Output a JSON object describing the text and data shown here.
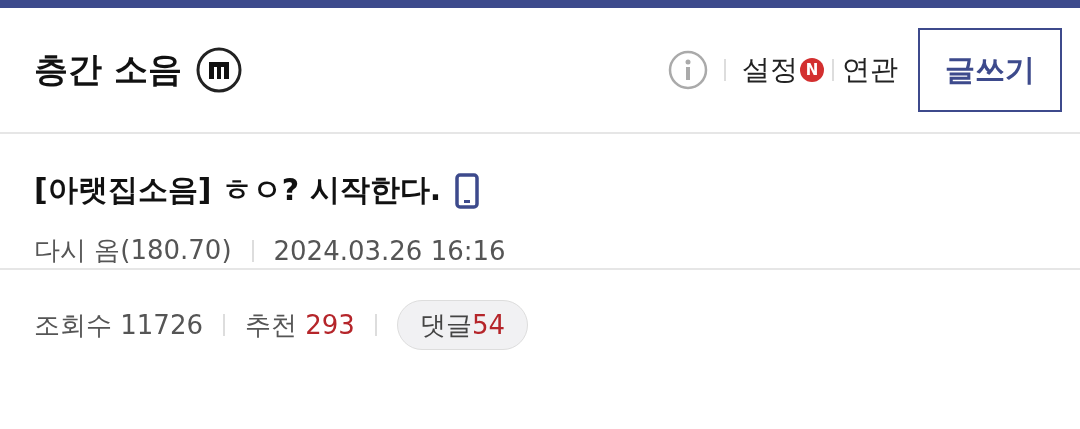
{
  "board": {
    "title": "층간 소음",
    "links": [
      {
        "label": "설정",
        "badge": "N"
      },
      {
        "label": "연관"
      }
    ],
    "write_button": "글쓰기"
  },
  "post": {
    "title": "[아랫집소음] ㅎㅇ? 시작한다.",
    "author": "다시 옴(180.70)",
    "date": "2024.03.26 16:16"
  },
  "stats": {
    "views_label": "조회수",
    "views": "11726",
    "recommend_label": "추천",
    "recommend": "293",
    "comments_label": "댓글",
    "comments": "54"
  }
}
